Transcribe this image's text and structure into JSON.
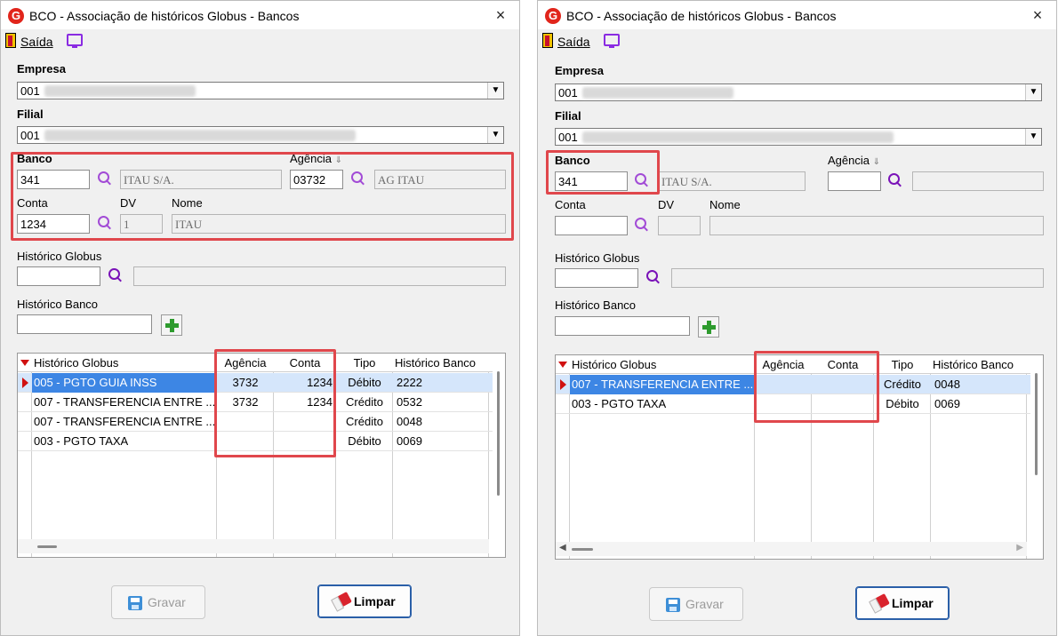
{
  "windows": [
    {
      "id": "left",
      "title": "BCO - Associação de históricos Globus - Bancos",
      "close_icon": "×",
      "toolbar": {
        "exit_label": "Saída"
      },
      "empresa": {
        "label": "Empresa",
        "value": "001"
      },
      "filial": {
        "label": "Filial",
        "value": "001"
      },
      "banco": {
        "label": "Banco",
        "code": "341",
        "name": "ITAU S/A."
      },
      "agencia": {
        "label": "Agência",
        "code": "03732",
        "name": "AG ITAU"
      },
      "conta": {
        "label": "Conta",
        "value": "1234"
      },
      "dv": {
        "label": "DV",
        "value": "1"
      },
      "nome": {
        "label": "Nome",
        "value": "ITAU"
      },
      "historico_globus": {
        "label": "Histórico Globus",
        "code": "",
        "desc": ""
      },
      "historico_banco": {
        "label": "Histórico Banco",
        "value": ""
      },
      "grid": {
        "columns": [
          "Histórico Globus",
          "Agência",
          "Conta",
          "Tipo",
          "Histórico Banco"
        ],
        "rows": [
          {
            "historico": "005 - PGTO GUIA INSS",
            "agencia": "3732",
            "conta": "1234",
            "tipo": "Débito",
            "banco": "2222"
          },
          {
            "historico": "007 - TRANSFERENCIA ENTRE ...",
            "agencia": "3732",
            "conta": "1234",
            "tipo": "Crédito",
            "banco": "0532"
          },
          {
            "historico": "007 - TRANSFERENCIA ENTRE ...",
            "agencia": "",
            "conta": "",
            "tipo": "Crédito",
            "banco": "0048"
          },
          {
            "historico": "003 - PGTO TAXA",
            "agencia": "",
            "conta": "",
            "tipo": "Débito",
            "banco": "0069"
          }
        ]
      },
      "buttons": {
        "save": "Gravar",
        "clear": "Limpar"
      }
    },
    {
      "id": "right",
      "title": "BCO - Associação de históricos Globus - Bancos",
      "close_icon": "×",
      "toolbar": {
        "exit_label": "Saída"
      },
      "empresa": {
        "label": "Empresa",
        "value": "001"
      },
      "filial": {
        "label": "Filial",
        "value": "001"
      },
      "banco": {
        "label": "Banco",
        "code": "341",
        "name": "ITAU S/A."
      },
      "agencia": {
        "label": "Agência",
        "code": "",
        "name": ""
      },
      "conta": {
        "label": "Conta",
        "value": ""
      },
      "dv": {
        "label": "DV",
        "value": ""
      },
      "nome": {
        "label": "Nome",
        "value": ""
      },
      "historico_globus": {
        "label": "Histórico Globus",
        "code": "",
        "desc": ""
      },
      "historico_banco": {
        "label": "Histórico Banco",
        "value": ""
      },
      "grid": {
        "columns": [
          "Histórico Globus",
          "Agência",
          "Conta",
          "Tipo",
          "Histórico Banco"
        ],
        "rows": [
          {
            "historico": "007 - TRANSFERENCIA ENTRE ...",
            "agencia": "",
            "conta": "",
            "tipo": "Crédito",
            "banco": "0048"
          },
          {
            "historico": "003 - PGTO TAXA",
            "agencia": "",
            "conta": "",
            "tipo": "Débito",
            "banco": "0069"
          }
        ]
      },
      "buttons": {
        "save": "Gravar",
        "clear": "Limpar"
      }
    }
  ],
  "colors": {
    "highlight": "#e0474c",
    "selected_row": "#d5e6fb",
    "selected_cell": "#3d86e4",
    "accent_search": "#a24bd6"
  },
  "icons": {
    "logo": "globus-logo-icon",
    "exit": "exit-door-icon",
    "monitor": "monitor-icon",
    "search": "search-icon",
    "add": "plus-icon",
    "save": "floppy-icon",
    "clear": "eraser-icon"
  }
}
